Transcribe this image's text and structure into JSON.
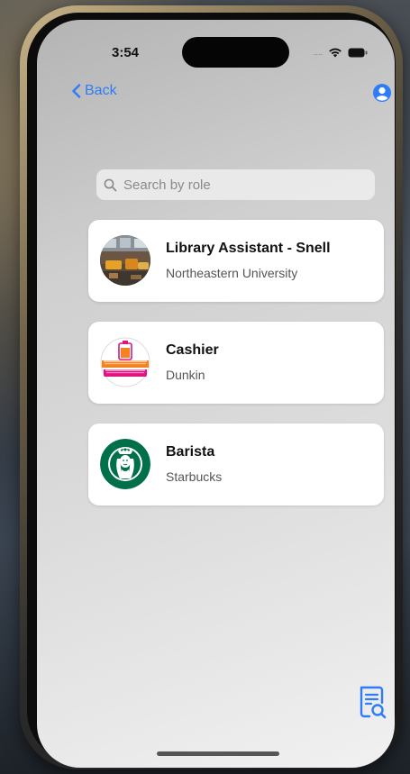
{
  "status_bar": {
    "time": "3:54",
    "signal": "....",
    "icons": [
      "wifi-icon",
      "battery-icon"
    ]
  },
  "nav": {
    "back_label": "Back",
    "profile_icon": "person-circle-icon"
  },
  "search": {
    "placeholder": "Search by role",
    "value": ""
  },
  "jobs": [
    {
      "title": "Library Assistant - Snell",
      "employer": "Northeastern University",
      "logo": "library-photo"
    },
    {
      "title": "Cashier",
      "employer": "Dunkin",
      "logo": "dunkin-logo"
    },
    {
      "title": "Barista",
      "employer": "Starbucks",
      "logo": "starbucks-logo"
    }
  ],
  "fab": {
    "icon": "document-search-icon"
  },
  "colors": {
    "accent": "#2f7cf6",
    "card": "#ffffff",
    "dunkin_orange": "#f5821f",
    "dunkin_pink": "#e11383",
    "starbucks_green": "#00704a"
  }
}
